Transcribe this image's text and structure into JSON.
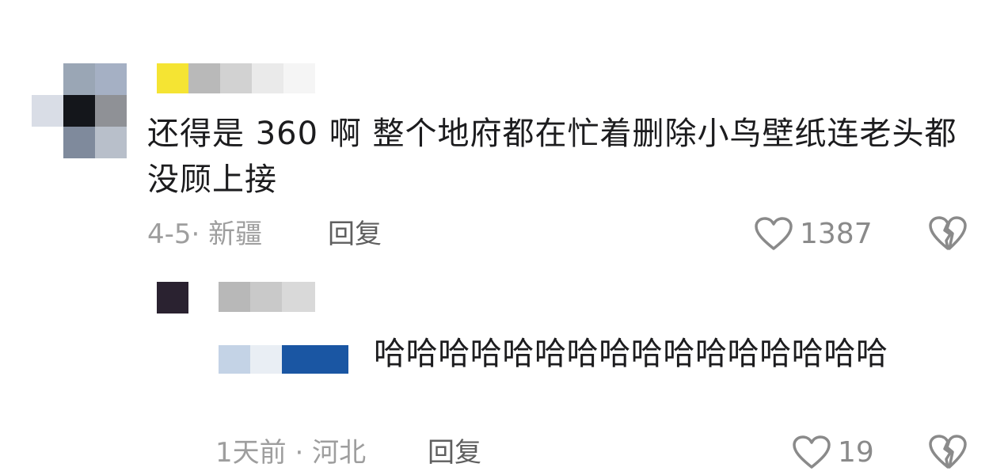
{
  "comments": [
    {
      "text": "还得是 360 啊 整个地府都在忙着删除小鸟壁纸连老头都没顾上接",
      "time": "4-5",
      "location": "新疆",
      "reply_label": "回复",
      "likes": "1387"
    },
    {
      "text": "哈哈哈哈哈哈哈哈哈哈哈哈哈哈哈哈",
      "time": "1天前",
      "location": "河北",
      "reply_label": "回复",
      "likes": "19"
    }
  ],
  "icons": {
    "like": "heart-outline-icon",
    "dislike": "broken-heart-icon"
  },
  "colors": {
    "text": "#1c1c1e",
    "meta": "#9e9e9e",
    "icon": "#8a8a8a"
  }
}
